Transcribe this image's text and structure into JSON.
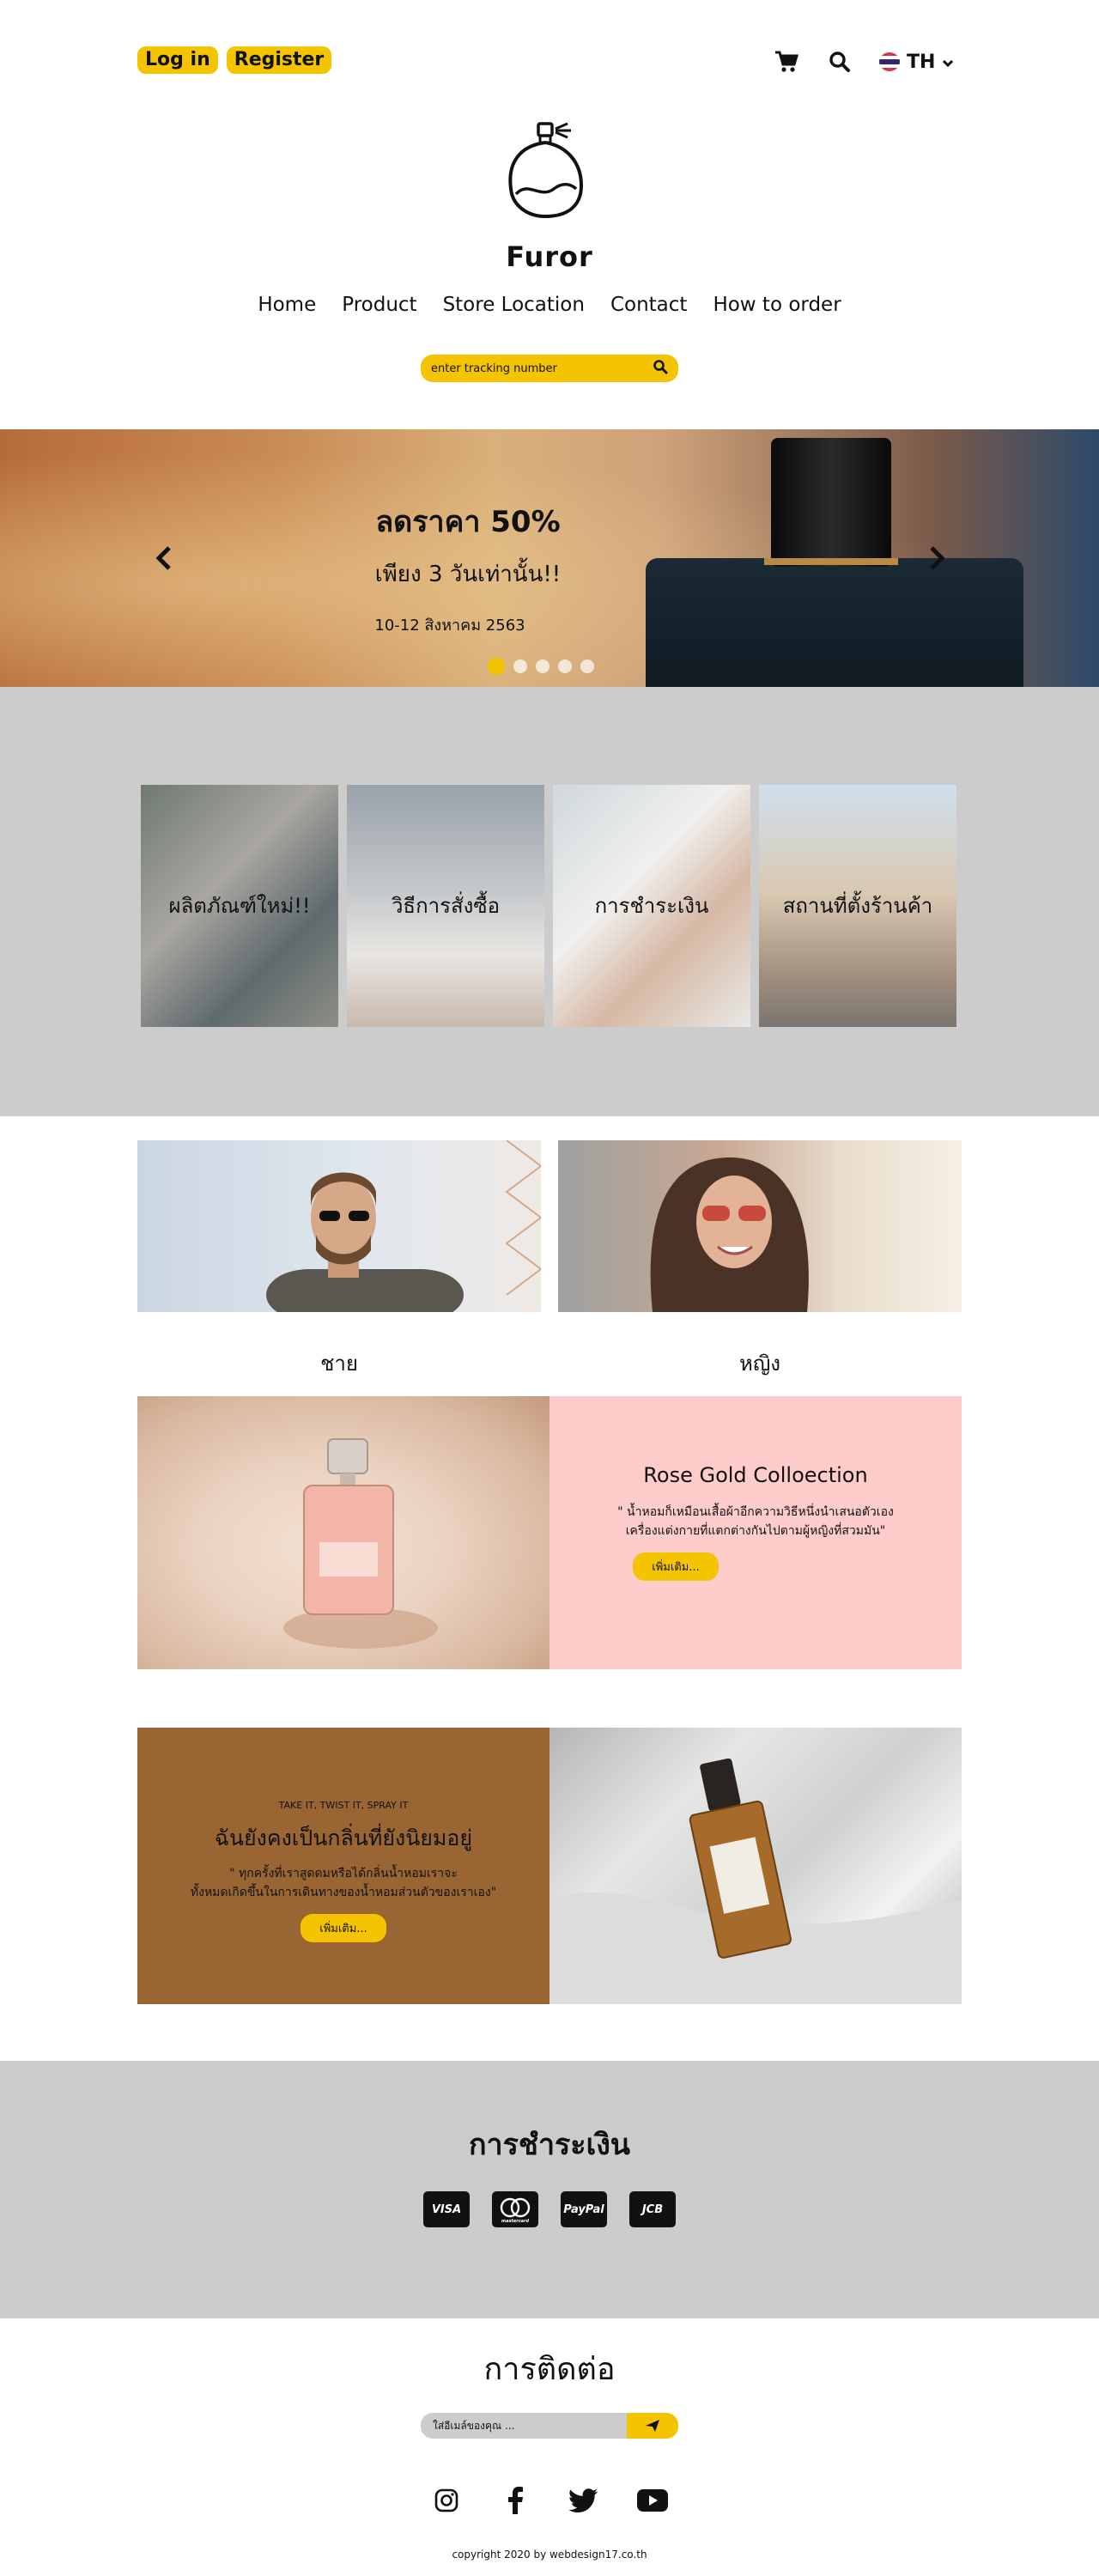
{
  "header": {
    "login_label": "Log in",
    "register_label": "Register",
    "lang_code": "TH"
  },
  "brand": {
    "name": "Furor"
  },
  "nav": {
    "items": [
      "Home",
      "Product",
      "Store Location",
      "Contact",
      "How to order"
    ]
  },
  "tracking": {
    "placeholder": "enter tracking number"
  },
  "banner": {
    "title": "ลดราคา 50%",
    "subtitle": "เพียง 3 วันเท่านั้น!!",
    "date": "10-12 สิงหาคม 2563",
    "slide_count": 5,
    "active_slide": 1
  },
  "categories": [
    {
      "label": "ผลิตภัณฑ์ใหม่!!"
    },
    {
      "label": "วิธีการสั่งซื้อ"
    },
    {
      "label": "การชำระเงิน"
    },
    {
      "label": "สถานที่ตั้งร้านค้า"
    }
  ],
  "gender": {
    "men_label": "ชาย",
    "women_label": "หญิง"
  },
  "rose_gold": {
    "title": "Rose Gold Colloection",
    "desc_line1": "\" น้ำหอมก็เหมือนเสื้อผ้าอีกความวิธีหนึ่งนำเสนอตัวเอง",
    "desc_line2": "เครื่องแต่งกายที่แตกต่างกันไปตามผู้หญิงที่สวมมัน\"",
    "button_label": "เพิ่มเติม..."
  },
  "promo": {
    "kicker": "TAKE IT, TWIST IT, SPRAY IT",
    "title": "ฉันยังคงเป็นกลิ่นที่ยังนิยมอยู่",
    "desc_line1": "\" ทุกครั้งที่เราสูดดมหรือได้กลิ่นน้ำหอมเราจะ",
    "desc_line2": "ทั้งหมดเกิดขึ้นในการเดินทางของน้ำหอมส่วนตัวของเราเอง\"",
    "button_label": "เพิ่มเติม..."
  },
  "payment": {
    "title": "การชำระเงิน",
    "methods": [
      "VISA",
      "mastercard",
      "PayPal",
      "JCB"
    ]
  },
  "contact": {
    "title": "การติดต่อ",
    "email_placeholder": "ใส่อีเมล์ของคุณ ...",
    "socials": [
      "instagram-icon",
      "facebook-icon",
      "twitter-icon",
      "youtube-icon"
    ]
  },
  "footer": {
    "copyright": "copyright 2020 by webdesign17.co.th"
  },
  "colors": {
    "accent": "#f5c400",
    "section_gray": "#cccccc",
    "rose": "#ffcccc",
    "brown": "#996633"
  }
}
